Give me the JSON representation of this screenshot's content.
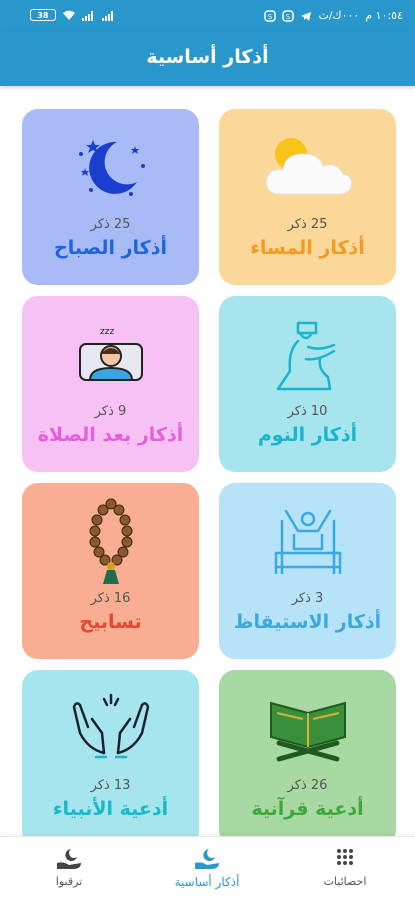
{
  "status_bar": {
    "time": "١٠:٥٤ م",
    "carrier": "٠٠٠ك/ث",
    "battery": "38"
  },
  "header": {
    "title": "أذكار أساسية"
  },
  "cards": [
    {
      "title": "أذكار المساء",
      "count": "25 ذكر",
      "color": "#fbd89a",
      "title_color": "#f29a22",
      "icon": "sun-cloud-icon"
    },
    {
      "title": "أذكار الصباح",
      "count": "25 ذكر",
      "color": "#a9bbf6",
      "title_color": "#1f63e0",
      "icon": "moon-stars-icon"
    },
    {
      "title": "أذكار النوم",
      "count": "10 ذكر",
      "color": "#a6e5ee",
      "title_color": "#1cb4cc",
      "icon": "praying-man-icon"
    },
    {
      "title": "أذكار بعد الصلاة",
      "count": "9 ذكر",
      "color": "#f8c1f6",
      "title_color": "#e360d8",
      "icon": "sleeping-person-icon"
    },
    {
      "title": "أذكار الاستيقاظ",
      "count": "3 ذكر",
      "color": "#b7e3f8",
      "title_color": "#39a9e0",
      "icon": "waking-up-bed-icon"
    },
    {
      "title": "تسابيح",
      "count": "16 ذكر",
      "color": "#f9ad93",
      "title_color": "#e7472c",
      "icon": "prayer-beads-icon"
    },
    {
      "title": "أدعية قرآنية",
      "count": "26 ذكر",
      "color": "#a9d9a3",
      "title_color": "#3da93a",
      "icon": "quran-stand-icon"
    },
    {
      "title": "أدعية الأنبياء",
      "count": "13 ذكر",
      "color": "#a6e5ee",
      "title_color": "#19b8c9",
      "icon": "praying-hands-icon"
    }
  ],
  "nav": {
    "left": "احصائيات",
    "center": "أذكار أساسية",
    "right": "ترقبوا"
  }
}
